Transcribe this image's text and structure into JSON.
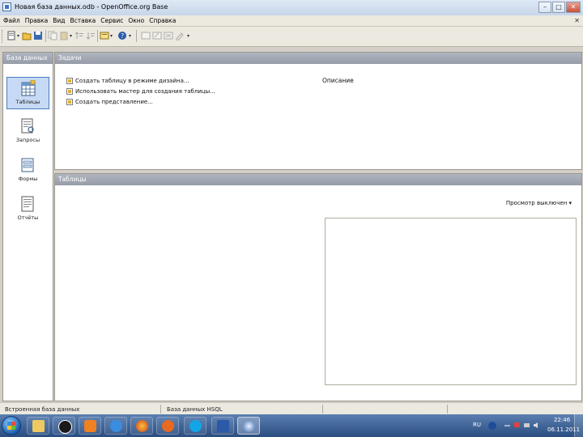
{
  "window": {
    "title": "Новая база данных.odb - OpenOffice.org Base",
    "min_glyph": "–",
    "max_glyph": "□",
    "close_glyph": "✕"
  },
  "menubar": {
    "items": [
      "Файл",
      "Правка",
      "Вид",
      "Вставка",
      "Сервис",
      "Окно",
      "Справка"
    ],
    "close_glyph": "✕"
  },
  "sidebar": {
    "title": "База данных",
    "items": [
      {
        "label": "Таблицы",
        "icon": "table-icon",
        "selected": true
      },
      {
        "label": "Запросы",
        "icon": "query-icon"
      },
      {
        "label": "Формы",
        "icon": "form-icon"
      },
      {
        "label": "Отчёты",
        "icon": "report-icon"
      }
    ]
  },
  "tasks": {
    "title": "Задачи",
    "items": [
      {
        "label": "Создать таблицу в режиме дизайна..."
      },
      {
        "label": "Использовать мастер для создания таблицы..."
      },
      {
        "label": "Создать представление..."
      }
    ],
    "description_label": "Описание"
  },
  "tables": {
    "title": "Таблицы",
    "preview_label": "Просмотр выключен"
  },
  "statusbar": {
    "left": "Встроенная база данных",
    "right": "База данных HSQL"
  },
  "taskbar": {
    "lang": "RU",
    "time": "22:46",
    "date": "06.11.2011"
  }
}
